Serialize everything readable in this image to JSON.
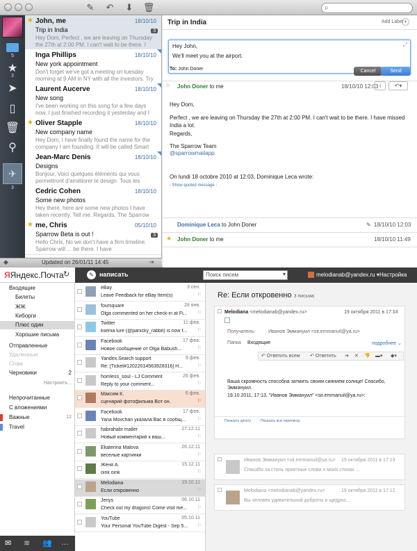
{
  "sparrow": {
    "search_placeholder": "",
    "side_counts": {
      "inbox": "5",
      "starred": "3",
      "bottom": "3"
    },
    "list": [
      {
        "from": "John, me",
        "count_badge": "3",
        "date": "18/10/10",
        "subject": "Trip in India",
        "preview": "Hey Dom, Perfect , we are leaving on Thursday the 27th at 2:00 PM. I can't wait to be there. I have",
        "starred": true,
        "selected": true,
        "flag": false
      },
      {
        "from": "Inga Phillips",
        "count_badge": "",
        "date": "18/10/10",
        "subject": "New york appointment",
        "preview": "Don't forget we've got a meeting on tuesday morning at 9 AM in NY with all the investors. Try to be there!",
        "starred": false,
        "selected": false,
        "flag": true
      },
      {
        "from": "Laurent Aucerve",
        "count_badge": "",
        "date": "18/10/10",
        "subject": "New song",
        "preview": "I've been working on this song for a few days now. I just finished recording it yesterday and I thought you",
        "starred": false,
        "selected": false,
        "flag": true
      },
      {
        "from": "Oliver Stapple",
        "count_badge": "",
        "date": "18/10/10",
        "subject": "New company name",
        "preview": "Hey Dom, I have finally found the name for the company I am founding. It will be called Smart Grains...",
        "starred": true,
        "selected": false,
        "flag": false
      },
      {
        "from": "Jean-Marc Denis",
        "count_badge": "",
        "date": "18/10/10",
        "subject": "Designs",
        "preview": "Bonjour, Voici quelques éléments qui vous permettront d'améliorer le design. Tous les dessins en",
        "starred": false,
        "selected": false,
        "flag": true
      },
      {
        "from": "Cedric Cohen",
        "count_badge": "",
        "date": "18/10/10",
        "subject": "Some new photos",
        "preview": "Hey there, here are some new photos I have taken recently. Tell me. Regards, The Sparrow Team",
        "starred": false,
        "selected": false,
        "flag": false
      },
      {
        "from": "me, Chris",
        "count_badge": "3",
        "date": "05/10/10",
        "subject": "Sparrow Beta is out !",
        "preview": "Hello Chris, No we don't have a firm timeline. Sparrow will ... be there. I have",
        "starred": true,
        "selected": false,
        "flag": false
      }
    ],
    "footer_status": "Updated on 26/01/11 14:45",
    "reader": {
      "thread_title": "Trip in India",
      "add_label": "Add Label",
      "compose": {
        "body_line1": "Hey John,",
        "body_line2": "We'll meet you at the airport.",
        "to_label": "To:",
        "to_value": "John Doner",
        "cancel": "Cancel",
        "send": "Send"
      },
      "message": {
        "from": "John Doner",
        "to": "to me",
        "date": "18/10/10 12:03",
        "greeting": "Hey Dom,",
        "body": "Perfect , we are leaving on Thursday the 27th at 2:00 PM. I can't wait to be there. I have missed India a lot.",
        "regards": "Regards,",
        "signature": "The Sparrow Team",
        "handle": "@sparrowmailapp",
        "quoted_header": "On lundi 18 octobre 2010 at 12:03, Dominique Leca wrote:",
        "show_quoted": "- Show quoted message -"
      },
      "collapsed": [
        {
          "from": "Dominique Leca",
          "to": "to John Doner",
          "date": "18/10/10 12:03"
        },
        {
          "from": "John Doner",
          "to": "to me",
          "date": "18/10/10 11:49"
        }
      ]
    }
  },
  "yandex": {
    "logo_text": "Яндекс.Почта",
    "compose_label": "написать",
    "search_placeholder": "Поиск писем",
    "account": "melodianab@yandex.ru",
    "settings": "Настройка",
    "folders": [
      {
        "label": "Входящие",
        "count": "",
        "indent": 0,
        "muted": false,
        "selected": false
      },
      {
        "label": "Билеты",
        "count": "",
        "indent": 1,
        "muted": false,
        "selected": false
      },
      {
        "label": "ЖЖ",
        "count": "",
        "indent": 1,
        "muted": false,
        "selected": false
      },
      {
        "label": "Киборги",
        "count": "",
        "indent": 1,
        "muted": false,
        "selected": false
      },
      {
        "label": "Плюс один",
        "count": "",
        "indent": 1,
        "muted": false,
        "selected": true
      },
      {
        "label": "Хорошие письма",
        "count": "",
        "indent": 1,
        "muted": false,
        "selected": false
      },
      {
        "label": "Отправленные",
        "count": "",
        "indent": 0,
        "muted": false,
        "selected": false
      },
      {
        "label": "Удаленные",
        "count": "",
        "indent": 0,
        "muted": true,
        "selected": false
      },
      {
        "label": "Спам",
        "count": "",
        "indent": 0,
        "muted": true,
        "selected": false
      },
      {
        "label": "Черновики",
        "count": "2",
        "indent": 0,
        "muted": false,
        "selected": false
      }
    ],
    "configure_link": "Настроить...",
    "labels": [
      {
        "label": "Непрочитанные",
        "count": ""
      },
      {
        "label": "С вложениями",
        "count": ""
      },
      {
        "label": "Важные",
        "count": "12"
      },
      {
        "label": "Travel",
        "count": ""
      }
    ],
    "list": [
      {
        "from": "eBay",
        "subject": "Leave Feedback for eBay Item(s)",
        "date": "3 сен.",
        "highlight": false
      },
      {
        "from": "foursquare",
        "subject": "Olga commented on her check-in at Fi...",
        "date": "28 янв.",
        "highlight": false
      },
      {
        "from": "Twitter",
        "subject": "ksenia lure (@panicky_rabbit) is now f...",
        "date": "11 фев.",
        "highlight": false
      },
      {
        "from": "Facebook",
        "subject": "Новое сообщение от Olga Babush...",
        "date": "17 фев.",
        "highlight": false
      },
      {
        "from": "Yandex.Search support",
        "subject": "Re: [Ticket#12022014563928316] Н...",
        "date": "9 фев.",
        "highlight": false
      },
      {
        "from": "homless_soul - LJ Comment",
        "subject": "Reply to your comment...",
        "date": "26 фев.",
        "highlight": false
      },
      {
        "from": "Максим К.",
        "subject": "сценарий фотофильма  Вот он.",
        "date": "6 фев.",
        "highlight": true
      },
      {
        "from": "Facebook",
        "subject": "Yana Movchan указала Вас в сообщ...",
        "date": "17 фев.",
        "highlight": false
      },
      {
        "from": "habrahabr mailer",
        "subject": "Новый комментарий к ваш...",
        "date": "27.12.11",
        "highlight": false
      },
      {
        "from": "Ekaterina Malova",
        "subject": "веселые картинки",
        "date": "26.12.11",
        "highlight": false
      },
      {
        "from": "Женя А.",
        "subject": "oink oink",
        "date": "15.12.11",
        "highlight": false
      },
      {
        "from": "Melodiana",
        "subject": "Если откровенно",
        "date": "19.10.11",
        "highlight": false,
        "selected": true
      },
      {
        "from": "Jenys",
        "subject": "Check out my dragons!  Come visit me...",
        "date": "06.10.11",
        "highlight": false
      },
      {
        "from": "YouTube",
        "subject": "Your Personal YouTube Digest - Sep 5...",
        "date": "05.10.11",
        "highlight": false
      }
    ],
    "reader": {
      "subject": "Re: Если откровенно",
      "count": "3 письма",
      "msg": {
        "from_name": "Melodiana",
        "from_email": "<melodianab@yandex.ru>",
        "date": "19 октября 2011 в 17:14",
        "recipients_label": "Получатель:",
        "recipients": "Иванов Эммануил <sir.emmanuil@ya.ru>",
        "folder_label": "Папка",
        "folder": "Входящие",
        "more": "подробнее",
        "reply_all": "Ответить всем",
        "reply": "Ответить",
        "body1": "Ваша скромность способна затмить своим сиянием солнце! Спасибо, Эммануил.",
        "body2": "19.10.2011, 17:13, \"Иванов Эммануил\" <sir.emmanuil@ya.ru>:",
        "show_quote": "Показать цитату",
        "show_thread": "Показать всю переписку"
      },
      "collapsed": [
        {
          "from": "Иванов Эммануил <sir.emmanuil@ya.ru>",
          "date": "19 октября 2011 в 17:13",
          "preview": "Спасибо за столь приятные слова о моих стихах ..."
        },
        {
          "from": "Melodiana <melodianab@yandex.ru>",
          "date": "19 октября 2011 в 17:12",
          "preview": "Вы человек удивительной доброты и щедрос..."
        }
      ]
    }
  }
}
